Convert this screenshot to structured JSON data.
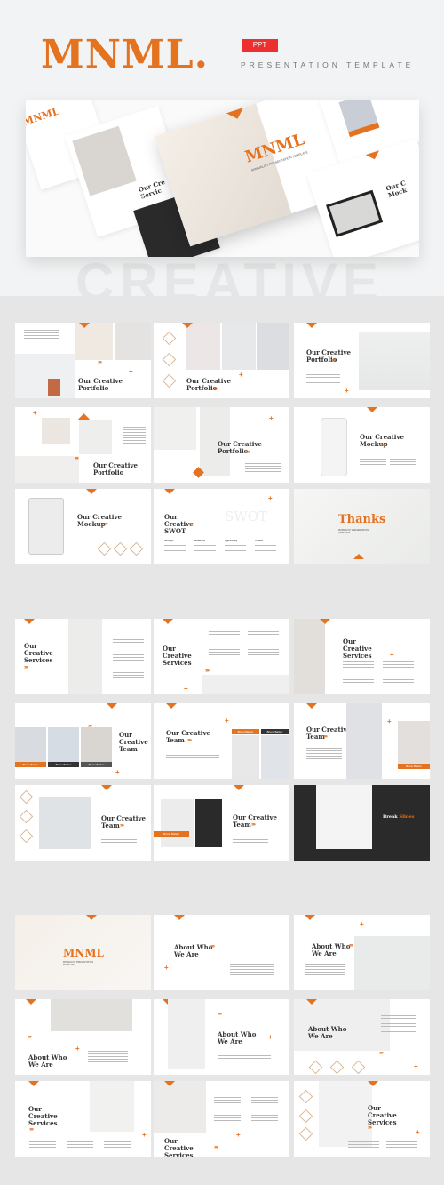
{
  "header": {
    "logo": "MNML.",
    "badge": "PPT",
    "subtitle": "PRESENTATION TEMPLATE",
    "ghost_text": "CREATIVE",
    "brand_color": "#e5721f",
    "badge_color": "#ee2f2f"
  },
  "showcase": {
    "center_title": "MNML",
    "center_subtitle": "MINIMALIST PRESENTATION TEMPLATE",
    "left_title": "MNML",
    "partial_services": "Our Cre Servic",
    "partial_mockup": "Our C Mock"
  },
  "common": {
    "kicker": "MINIMALIST PRESENTATION TEMPLATE",
    "chevrons": "››››",
    "plus": "+"
  },
  "sections": [
    {
      "slides": [
        {
          "title": "Our Creative Portfolio"
        },
        {
          "title": "Our Creative Portfolio"
        },
        {
          "title": "Our Creative Portfolio"
        },
        {
          "title": "Our Creative Portfolio"
        },
        {
          "title": "Our Creative Portfolio"
        },
        {
          "title": "Our Creative Mockup"
        },
        {
          "title": "Our Creative Mockup"
        },
        {
          "title": "Our Creative SWOT",
          "watermark": "SWOT",
          "columns": [
            "Strength",
            "Weakness",
            "Opportunity",
            "Threats"
          ]
        },
        {
          "title": "Thanks",
          "subtitle": "MINIMALIST PRESENTATION TEMPLATE"
        }
      ]
    },
    {
      "slides": [
        {
          "title": "Our Creative Services"
        },
        {
          "title": "Our Creative Services"
        },
        {
          "title": "Our Creative Services"
        },
        {
          "title": "Our Creative Team",
          "members": [
            "Bruno Barker",
            "Bruno Barker",
            "Bruno Barker"
          ]
        },
        {
          "title": "Our Creative Team",
          "members": [
            "Bruno Barker",
            "Bruno Barker"
          ]
        },
        {
          "title": "Our Creative Team",
          "members": [
            "Bruno Barker"
          ]
        },
        {
          "title": "Our Creative Team"
        },
        {
          "title": "Our Creative Team",
          "members": [
            "Bruno Barker"
          ]
        },
        {
          "title": "Break Slides",
          "title_a": "Break",
          "title_b": "Slides"
        }
      ]
    },
    {
      "slides": [
        {
          "title": "MNML",
          "subtitle": "MINIMALIST PRESENTATION TEMPLATE"
        },
        {
          "title": "About Who We Are"
        },
        {
          "title": "About Who We Are"
        },
        {
          "title": "About Who We Are"
        },
        {
          "title": "About Who We Are"
        },
        {
          "title": "About Who We Are"
        },
        {
          "title": "Our Creative Services"
        },
        {
          "title": "Our Creative Services"
        },
        {
          "title": "Our Creative Services"
        }
      ]
    }
  ]
}
